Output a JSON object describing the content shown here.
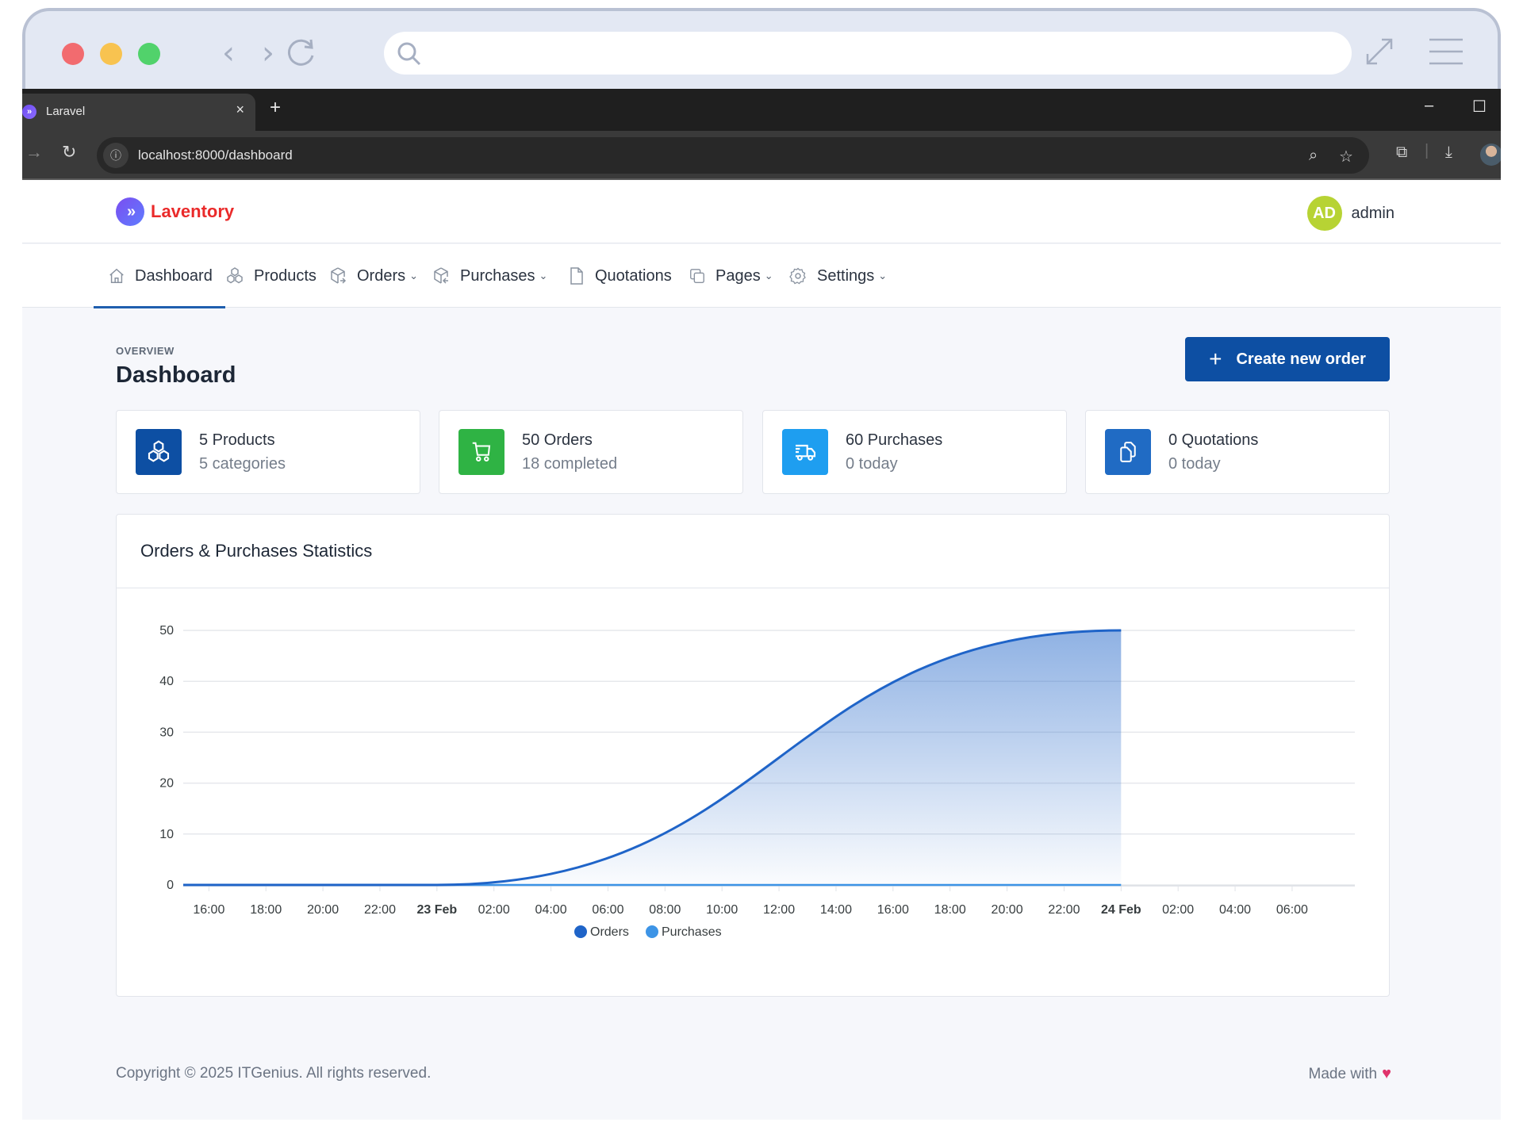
{
  "browser_mock": {
    "search_placeholder": ""
  },
  "browser": {
    "tab_title": "Laravel",
    "tab_close": "×",
    "new_tab": "+",
    "url": "localhost:8000/dashboard"
  },
  "header": {
    "brand": "Laventory",
    "avatar_initials": "AD",
    "user_name": "admin"
  },
  "nav": {
    "items": [
      {
        "label": "Dashboard",
        "icon": "home-icon",
        "dropdown": false,
        "active": true
      },
      {
        "label": "Products",
        "icon": "boxes-icon",
        "dropdown": false,
        "active": false
      },
      {
        "label": "Orders",
        "icon": "package-export-icon",
        "dropdown": true,
        "active": false
      },
      {
        "label": "Purchases",
        "icon": "package-import-icon",
        "dropdown": true,
        "active": false
      },
      {
        "label": "Quotations",
        "icon": "file-icon",
        "dropdown": false,
        "active": false
      },
      {
        "label": "Pages",
        "icon": "copy-icon",
        "dropdown": true,
        "active": false
      },
      {
        "label": "Settings",
        "icon": "settings-icon",
        "dropdown": true,
        "active": false
      }
    ],
    "chevron": "⌄"
  },
  "page": {
    "pretitle": "OVERVIEW",
    "title": "Dashboard",
    "create_button": "Create new order",
    "create_button_icon": "+"
  },
  "stats": [
    {
      "title": "5 Products",
      "subtitle": "5 categories",
      "icon": "boxes-icon",
      "color": "#0d4fa3"
    },
    {
      "title": "50 Orders",
      "subtitle": "18 completed",
      "icon": "shopping-cart-icon",
      "color": "#2fb344"
    },
    {
      "title": "60 Purchases",
      "subtitle": "0 today",
      "icon": "truck-delivery-icon",
      "color": "#1e9ef0"
    },
    {
      "title": "0 Quotations",
      "subtitle": "0 today",
      "icon": "copy-icon",
      "color": "#206bc4"
    }
  ],
  "chart_data": {
    "type": "area",
    "title": "Orders & Purchases Statistics",
    "xlabel": "",
    "ylabel": "",
    "ylim": [
      0,
      50
    ],
    "yticks": [
      0,
      10,
      20,
      30,
      40,
      50
    ],
    "xaxis_unit": "hours since 22 Feb 00:00",
    "xlim": [
      15.1,
      56.2
    ],
    "xticks": [
      {
        "label": "16:00",
        "x": 16,
        "bold": false
      },
      {
        "label": "18:00",
        "x": 18,
        "bold": false
      },
      {
        "label": "20:00",
        "x": 20,
        "bold": false
      },
      {
        "label": "22:00",
        "x": 22,
        "bold": false
      },
      {
        "label": "23 Feb",
        "x": 24,
        "bold": true
      },
      {
        "label": "02:00",
        "x": 26,
        "bold": false
      },
      {
        "label": "04:00",
        "x": 28,
        "bold": false
      },
      {
        "label": "06:00",
        "x": 30,
        "bold": false
      },
      {
        "label": "08:00",
        "x": 32,
        "bold": false
      },
      {
        "label": "10:00",
        "x": 34,
        "bold": false
      },
      {
        "label": "12:00",
        "x": 36,
        "bold": false
      },
      {
        "label": "14:00",
        "x": 38,
        "bold": false
      },
      {
        "label": "16:00",
        "x": 40,
        "bold": false
      },
      {
        "label": "18:00",
        "x": 42,
        "bold": false
      },
      {
        "label": "20:00",
        "x": 44,
        "bold": false
      },
      {
        "label": "22:00",
        "x": 46,
        "bold": false
      },
      {
        "label": "24 Feb",
        "x": 48,
        "bold": true
      },
      {
        "label": "02:00",
        "x": 50,
        "bold": false
      },
      {
        "label": "04:00",
        "x": 52,
        "bold": false
      },
      {
        "label": "06:00",
        "x": 54,
        "bold": false
      }
    ],
    "series": [
      {
        "name": "Orders",
        "color": "#1f64c8",
        "x": [
          15.1,
          24,
          48
        ],
        "values": [
          0,
          0,
          50
        ]
      },
      {
        "name": "Purchases",
        "color": "#3d94e6",
        "x": [
          15.1,
          24,
          48
        ],
        "values": [
          0,
          0,
          0
        ]
      }
    ],
    "grid": true,
    "legend": "bottom-center"
  },
  "footer": {
    "copyright": "Copyright © 2025 ITGenius. All rights reserved.",
    "made_with": "Made with",
    "heart": "♥"
  }
}
